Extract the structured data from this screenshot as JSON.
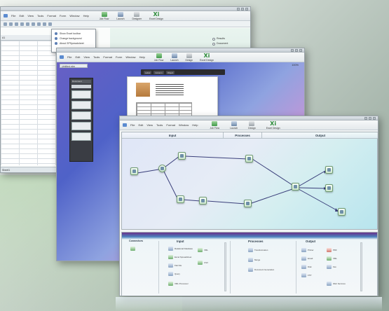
{
  "window1": {
    "menu": [
      "File",
      "Edit",
      "View",
      "Tools",
      "Format",
      "Form",
      "Window",
      "Help"
    ],
    "ribbon": {
      "flow_label": "Job Flow",
      "item2": "Launch",
      "item3": "Designer",
      "xi_label": "Xi",
      "xi_sub": "Excel Design"
    },
    "cell_ref": "A1",
    "dropdown": [
      "Show Excel toolbar",
      "Change background",
      "About SPSpreadsheet"
    ],
    "radio1": "Results",
    "radio2": "Document",
    "sheet_tab": "Sheet1"
  },
  "window2": {
    "menu": [
      "File",
      "Edit",
      "View",
      "Tools",
      "Format",
      "Form",
      "Window",
      "Help"
    ],
    "ribbon": {
      "flow_label": "Job Flow",
      "item2": "Launch",
      "item3": "Design",
      "xi_label": "Xi",
      "xi_sub": "Excel Design"
    },
    "doc_tab": "Untitled.rdm",
    "darkbar": [
      "Label",
      "Column",
      "Object"
    ],
    "panel_title": "Document",
    "zoom": "100%",
    "page_label": "1"
  },
  "window3": {
    "menu": [
      "File",
      "Edit",
      "View",
      "Tools",
      "Format",
      "Window",
      "Help"
    ],
    "ribbon": {
      "flow_label": "Job Flow",
      "item2": "Launch",
      "item3": "Design",
      "xi_label": "Xi",
      "xi_sub": "Excel Design"
    },
    "columns": [
      "Input",
      "Processes",
      "Output"
    ],
    "palette": {
      "connectors": "Connectors",
      "input": "Input",
      "processes": "Processes",
      "output": "Output",
      "input_items": [
        "Relational Database",
        "XML",
        "Excel Spreadsheet",
        "CSV",
        "Flat File",
        "Query",
        "XML Processor"
      ],
      "process_items": [
        "Transformation",
        "Merge",
        "Document Generation"
      ],
      "output_items": [
        "Printer",
        "Email",
        "Disk",
        "FTP",
        "PDF",
        "XML",
        "Fax",
        "Web Services"
      ]
    }
  },
  "colors": {
    "accent_green": "#3f9a48",
    "flow_edge": "#3a3f7a",
    "bg": "#cfd9d2"
  }
}
